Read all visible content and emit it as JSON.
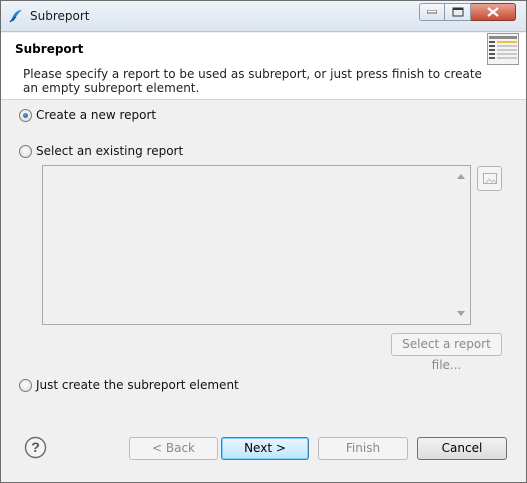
{
  "window": {
    "title": "Subreport"
  },
  "header": {
    "title": "Subreport",
    "description": "Please specify a report to be used as subreport, or just press finish to create an empty subreport element."
  },
  "options": {
    "create_new": "Create a new report",
    "select_existing": "Select an existing report",
    "just_create": "Just create the subreport element",
    "selected": "create_new"
  },
  "existing_report": {
    "select_file_label": "Select a report file..."
  },
  "footer": {
    "back_label": "< Back",
    "next_label": "Next >",
    "finish_label": "Finish",
    "cancel_label": "Cancel"
  },
  "colors": {
    "accent": "#3c7fb1",
    "close_button": "#c74a33"
  }
}
